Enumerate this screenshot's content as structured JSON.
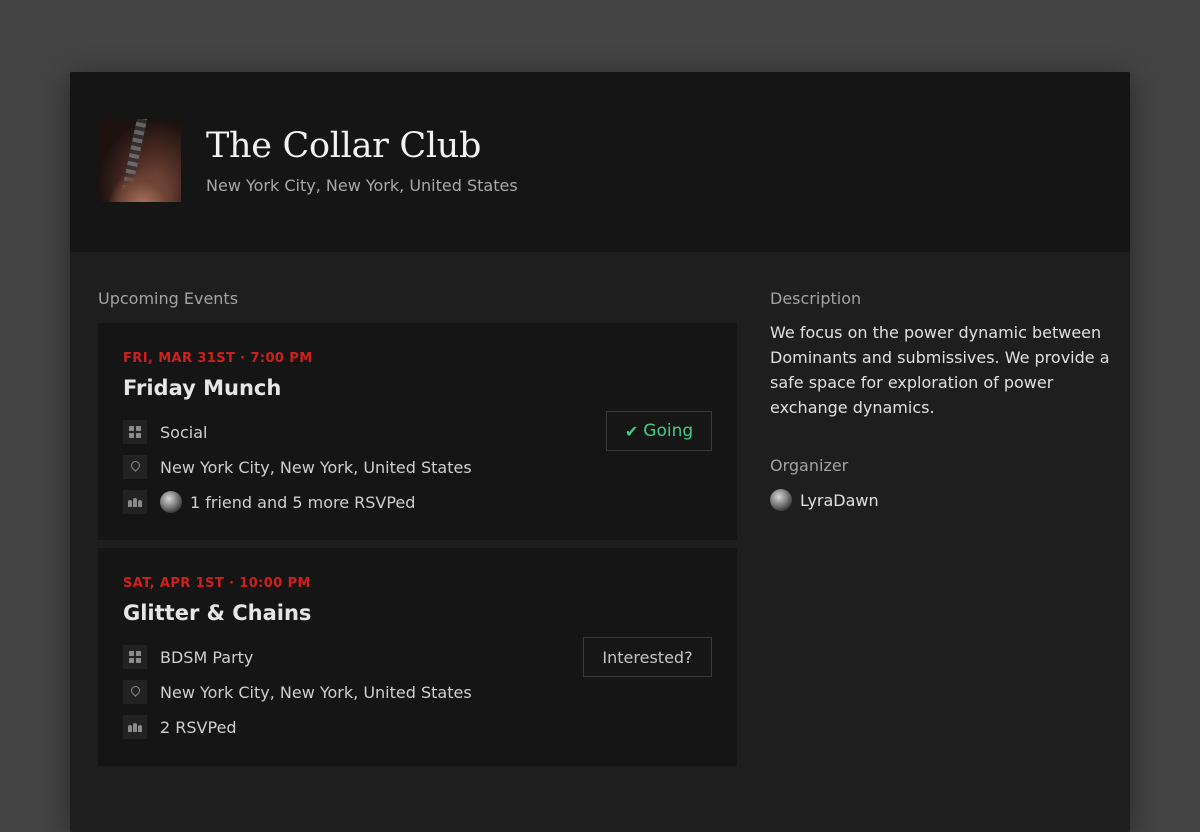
{
  "group": {
    "title": "The Collar Club",
    "location": "New York City, New York, United States"
  },
  "sections": {
    "upcoming_events": "Upcoming Events",
    "description": "Description",
    "organizer": "Organizer"
  },
  "events": [
    {
      "date": "FRI, MAR 31ST · 7:00 PM",
      "title": "Friday Munch",
      "category": "Social",
      "location": "New York City, New York, United States",
      "rsvp": "1 friend and 5 more RSVPed",
      "button_label": "Going",
      "button_icon": "check-icon",
      "button_color": "#3fcc84"
    },
    {
      "date": "SAT, APR 1ST · 10:00 PM",
      "title": "Glitter & Chains",
      "category": "BDSM Party",
      "location": "New York City, New York, United States",
      "rsvp": "2 RSVPed",
      "button_label": "Interested?"
    }
  ],
  "description": "We focus on the power dynamic between Dominants and submissives. We provide a safe space for exploration of power exchange dynamics.",
  "organizer": {
    "name": "LyraDawn"
  },
  "colors": {
    "date_accent": "#d0201c",
    "going_green": "#3fcc84",
    "background": "#444444",
    "card": "#1e1e1e"
  }
}
